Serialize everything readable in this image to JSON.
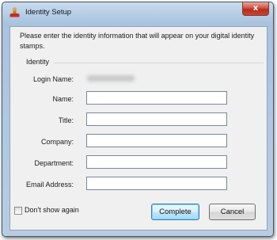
{
  "window": {
    "title": "Identity Setup",
    "close_glyph": "x"
  },
  "intro_text": "Please enter the identity information that will appear on your digital identity stamps.",
  "group": {
    "label": "Identity"
  },
  "fields": {
    "login_name": {
      "label": "Login Name:",
      "value": ""
    },
    "name": {
      "label": "Name:",
      "value": ""
    },
    "title": {
      "label": "Title:",
      "value": ""
    },
    "company": {
      "label": "Company:",
      "value": ""
    },
    "department": {
      "label": "Department:",
      "value": ""
    },
    "email": {
      "label": "Email Address:",
      "value": ""
    }
  },
  "footer": {
    "dont_show_again_label": "Don't show again",
    "dont_show_again_checked": false,
    "complete_label": "Complete",
    "cancel_label": "Cancel"
  },
  "icons": {
    "app": "stamp-icon",
    "close": "close-icon"
  },
  "colors": {
    "title_bar": "#b8cde4",
    "close_button": "#c9442f",
    "default_button_border": "#3c7fb1"
  }
}
